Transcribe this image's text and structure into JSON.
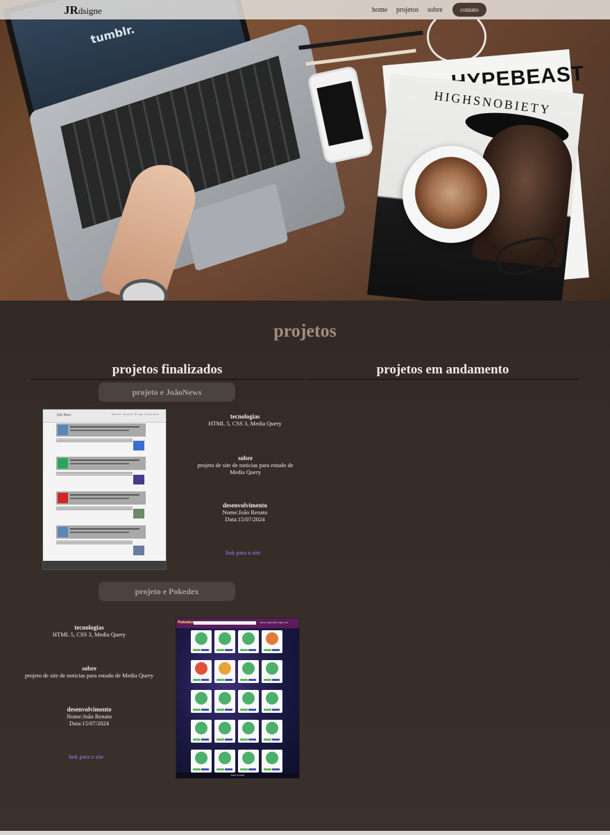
{
  "navbar": {
    "logo_main": "JR",
    "logo_rest": "dsigne",
    "links": [
      "home",
      "projetos",
      "sobre"
    ],
    "contact_label": "contato"
  },
  "hero": {
    "screen_text": "tumblr.",
    "magazine_titles": [
      "HYPEBEAST",
      "HIGHSNOBIETY"
    ]
  },
  "main": {
    "title": "projetos",
    "finished_heading": "projetos finalizados",
    "in_progress_heading": "projetos em andamento",
    "projects": [
      {
        "label": "projeto e JoãoNews",
        "tech_title": "tecnologias",
        "tech_text": "HTML 5, CSS 3, Media Query",
        "about_title": "sobre",
        "about_text": "projeto de site de noticias para estudo de Media Query",
        "dev_title": "desenvolvimento",
        "dev_name": "Nome:João Renato",
        "dev_date": "Data:15/07/2024",
        "link_text": "link para o site",
        "thumb_logo": "João News",
        "thumb_nav": "Home Sobre Blog Contato"
      },
      {
        "label": "projeto e Pokedex",
        "tech_title": "tecnologias",
        "tech_text": "HTML 5, CSS 3, Media Query",
        "about_title": "sobre",
        "about_text": "projeto de site de noticias para estudo de Media Query",
        "dev_title": "desenvolvimento",
        "dev_name": "Nome:João Renato",
        "dev_date": "Data:15/07/2024",
        "link_text": "link para o site",
        "thumb_logo": "Pokédex",
        "thumb_nav": "home  pokedex  sign out",
        "thumb_footer": "joão renato"
      }
    ]
  },
  "colors": {
    "background": "#342b27",
    "accent_title": "#a68a80",
    "link": "#8a8cf0",
    "contact_button": "#4b3a31"
  }
}
